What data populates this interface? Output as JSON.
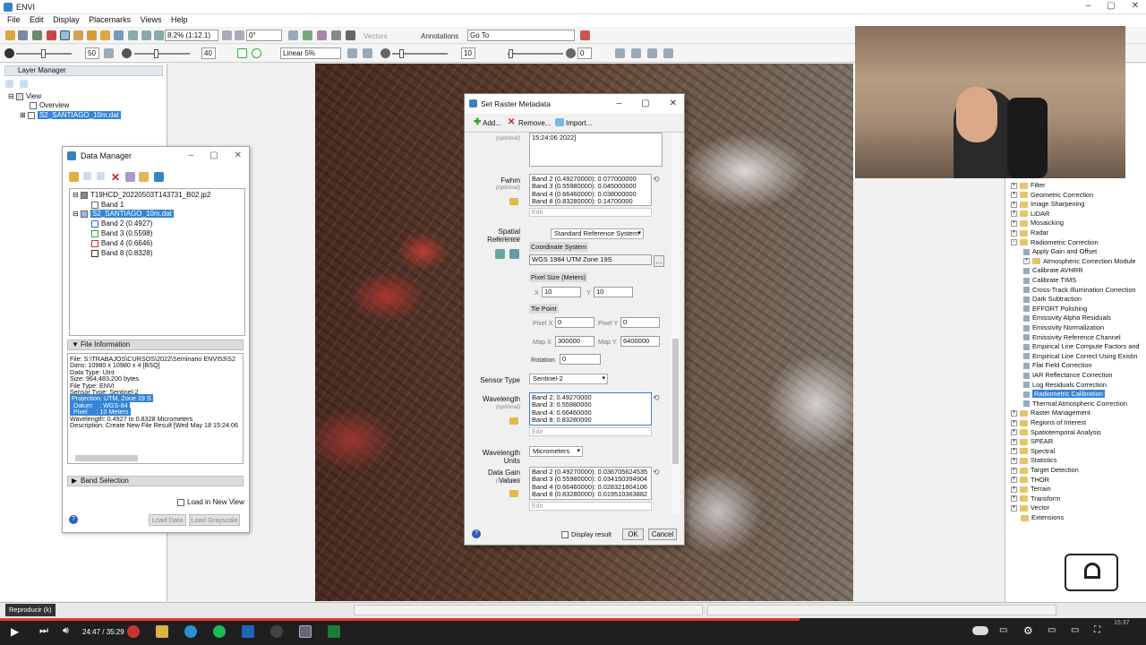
{
  "app": {
    "title": "ENVI"
  },
  "menu": [
    "File",
    "Edit",
    "Display",
    "Placemarks",
    "Views",
    "Help"
  ],
  "toolbar": {
    "zoom": "8.2% (1:12.1)",
    "rotation": "0°",
    "vectors_label": "Vectors",
    "annotations_label": "Annotations",
    "goto_label": "Go To",
    "brightness_value": "50",
    "contrast_value": "40",
    "stretch": "Linear 5%",
    "sharpen_value": "10",
    "transparency_value": "0"
  },
  "layer_manager": {
    "title": "Layer Manager",
    "items": [
      "View",
      "Overview",
      "S2_SANTIAGO_10m.dat"
    ]
  },
  "data_manager": {
    "title": "Data Manager",
    "tree": [
      "T19HCD_20220503T143731_B02.jp2",
      "Band 1",
      "S2_SANTIAGO_10m.dat",
      "Band 2 (0.4927)",
      "Band 3 (0.5598)",
      "Band 4 (0.6646)",
      "Band 8 (0.8328)"
    ],
    "file_info_label": "File Information",
    "file_info": [
      "File: S:\\TRABAJOS\\CURSOS\\2022\\Seminario ENVI53\\S2",
      "Dims: 10980 x 10980 x 4 [BSQ]",
      "Data Type: UInt",
      "Size: 964,483,200 bytes",
      "File Type: ENVI",
      " Sensor Type: Sentinel-2",
      "Projection: UTM, Zone 19 S",
      " Datum    : WGS-84",
      " Pixel     : 10 Meters",
      "Wavelength: 0.4927 to 0.8328 Micrometers",
      "Description: Create New File Result [Wed May 18 15:24:06"
    ],
    "band_selection_label": "Band Selection",
    "load_new_view": "Load in New View",
    "load_data": "Load Data",
    "load_grayscale": "Load Grayscale"
  },
  "dialog": {
    "title": "Set Raster Metadata",
    "add_label": "Add...",
    "remove_label": "Remove...",
    "import_label": "Import...",
    "optional": "(optional)",
    "top_text": "15:24:06 2022]",
    "fwhm_label": "Fwhm",
    "fwhm": [
      "Band 2 (0.49270000): 0.077000000",
      "Band 3 (0.55980000): 0.045000000",
      "Band 4 (0.66460000): 0.038000000",
      "Band 8 (0.83280000): 0.14700000"
    ],
    "edit_label": "Edit",
    "spatial_ref_label": "Spatial Reference",
    "spatial_ref_value": "Standard Reference System",
    "coord_system_label": "Coordinate System",
    "coord_system_value": "WGS 1984 UTM Zone 19S",
    "pixel_size_label": "Pixel Size (Meters)",
    "x_label": "X",
    "x_value": "10",
    "y_label": "Y",
    "y_value": "10",
    "tie_point_label": "Tie Point",
    "pixel_x_label": "Pixel X",
    "pixel_x_value": "0",
    "pixel_y_label": "Pixel Y",
    "pixel_y_value": "0",
    "map_x_label": "Map X",
    "map_x_value": "300000",
    "map_y_label": "Map Y",
    "map_y_value": "6400000",
    "rotation_label": "Rotation",
    "rotation_value": "0",
    "sensor_type_label": "Sensor Type",
    "sensor_type_value": "Sentinel-2",
    "wavelength_label": "Wavelength",
    "wavelength": [
      "Band 2: 0.49270000",
      "Band 3: 0.55980000",
      "Band 4: 0.66460000",
      "Band 8: 0.83280000"
    ],
    "wavelength_units_label": "Wavelength Units",
    "wavelength_units_value": "Micrometers",
    "gain_label": "Data Gain Values",
    "gain": [
      "Band 2 (0.49270000): 0.036705624535",
      "Band 3 (0.55980000): 0.034150394904",
      "Band 4 (0.66460000): 0.028321804106",
      "Band 8 (0.83280000): 0.019510363882"
    ],
    "display_result": "Display result",
    "ok": "OK",
    "cancel": "Cancel"
  },
  "toolbox": {
    "items": [
      {
        "label": "Filter",
        "level": 0,
        "type": "folder"
      },
      {
        "label": "Geometric Correction",
        "level": 0,
        "type": "folder"
      },
      {
        "label": "Image Sharpening",
        "level": 0,
        "type": "folder"
      },
      {
        "label": "LiDAR",
        "level": 0,
        "type": "folder"
      },
      {
        "label": "Mosaicking",
        "level": 0,
        "type": "folder"
      },
      {
        "label": "Radar",
        "level": 0,
        "type": "folder"
      },
      {
        "label": "Radiometric Correction",
        "level": 0,
        "type": "open"
      },
      {
        "label": "Apply Gain and Offset",
        "level": 1,
        "type": "tool"
      },
      {
        "label": "Atmospheric Correction Module",
        "level": 1,
        "type": "folder"
      },
      {
        "label": "Calibrate AVHRR",
        "level": 1,
        "type": "tool"
      },
      {
        "label": "Calibrate TIMS",
        "level": 1,
        "type": "tool"
      },
      {
        "label": "Cross-Track Illumination Correction",
        "level": 1,
        "type": "tool"
      },
      {
        "label": "Dark Subtraction",
        "level": 1,
        "type": "tool"
      },
      {
        "label": "EFFORT Polishing",
        "level": 1,
        "type": "tool"
      },
      {
        "label": "Emissivity Alpha Residuals",
        "level": 1,
        "type": "tool"
      },
      {
        "label": "Emissivity Normalization",
        "level": 1,
        "type": "tool"
      },
      {
        "label": "Emissivity Reference Channel",
        "level": 1,
        "type": "tool"
      },
      {
        "label": "Empirical Line Compute Factors and",
        "level": 1,
        "type": "tool"
      },
      {
        "label": "Empirical Line Correct Using Existin",
        "level": 1,
        "type": "tool"
      },
      {
        "label": "Flat Field Correction",
        "level": 1,
        "type": "tool"
      },
      {
        "label": "IAR Reflectance Correction",
        "level": 1,
        "type": "tool"
      },
      {
        "label": "Log Residuals Correction",
        "level": 1,
        "type": "tool"
      },
      {
        "label": "Radiometric Calibration",
        "level": 1,
        "type": "selected"
      },
      {
        "label": "Thermal Atmospheric Correction",
        "level": 1,
        "type": "tool"
      },
      {
        "label": "Raster Management",
        "level": 0,
        "type": "folder"
      },
      {
        "label": "Regions of Interest",
        "level": 0,
        "type": "folder"
      },
      {
        "label": "Spatiotemporal Analysis",
        "level": 0,
        "type": "folder"
      },
      {
        "label": "SPEAR",
        "level": 0,
        "type": "folder"
      },
      {
        "label": "Spectral",
        "level": 0,
        "type": "folder"
      },
      {
        "label": "Statistics",
        "level": 0,
        "type": "folder"
      },
      {
        "label": "Target Detection",
        "level": 0,
        "type": "folder"
      },
      {
        "label": "THOR",
        "level": 0,
        "type": "folder"
      },
      {
        "label": "Terrain",
        "level": 0,
        "type": "folder"
      },
      {
        "label": "Transform",
        "level": 0,
        "type": "folder"
      },
      {
        "label": "Vector",
        "level": 0,
        "type": "folder"
      },
      {
        "label": "Extensions",
        "level": 0,
        "type": "folderonly"
      }
    ]
  },
  "player": {
    "tooltip": "Reproducir (k)",
    "time": "24:47 / 35:29",
    "progress_fraction": 0.698,
    "clock": "15:37"
  },
  "colors": {
    "selection": "#3584d6",
    "progress": "#e33333"
  }
}
